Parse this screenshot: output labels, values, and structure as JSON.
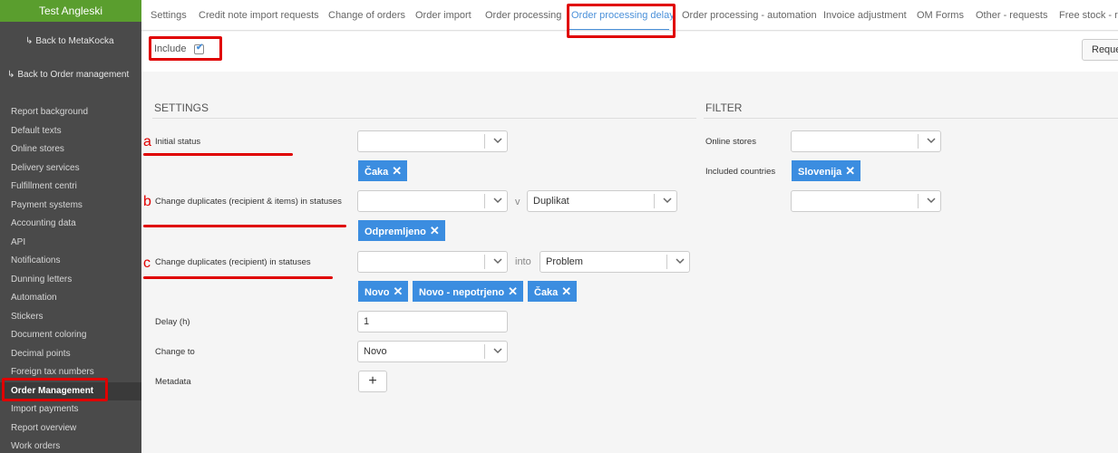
{
  "sidebar": {
    "title": "Test Angleski",
    "back_metakocka": "Back to MetaKocka",
    "back_order_management": "Back to Order management",
    "items": [
      "Report background",
      "Default texts",
      "Online stores",
      "Delivery services",
      "Fulfillment centri",
      "Payment systems",
      "Accounting data",
      "API",
      "Notifications",
      "Dunning letters",
      "Automation",
      "Stickers",
      "Document coloring",
      "Decimal points",
      "Foreign tax numbers",
      "Order Management",
      "Import payments",
      "Report overview",
      "Work orders"
    ],
    "active_item": "Order Management"
  },
  "tabs": [
    "Settings",
    "Credit note import requests",
    "Change of orders",
    "Order import",
    "Order processing",
    "Order processing delay",
    "Order processing - automation",
    "Invoice adjustment",
    "OM Forms",
    "Other - requests",
    "Free stock - res"
  ],
  "active_tab": "Order processing delay",
  "include": {
    "label": "Include",
    "checked": true
  },
  "request_button": "Reque",
  "settings": {
    "title": "SETTINGS",
    "initial_status": {
      "label": "Initial status",
      "value": "",
      "tags": [
        "Čaka"
      ]
    },
    "change_duplicates_items": {
      "label": "Change duplicates (recipient & items) in statuses",
      "value": "",
      "joiner": "v",
      "target": "Duplikat",
      "tags": [
        "Odpremljeno"
      ]
    },
    "change_duplicates_recipient": {
      "label": "Change duplicates (recipient) in statuses",
      "value": "",
      "joiner": "into",
      "target": "Problem",
      "tags": [
        "Novo",
        "Novo - nepotrjeno",
        "Čaka"
      ]
    },
    "delay": {
      "label": "Delay (h)",
      "value": "1"
    },
    "change_to": {
      "label": "Change to",
      "value": "Novo"
    },
    "metadata": {
      "label": "Metadata",
      "button": "+"
    }
  },
  "filter": {
    "title": "FILTER",
    "online_stores": {
      "label": "Online stores",
      "value": ""
    },
    "included_countries": {
      "label": "Included countries",
      "tags": [
        "Slovenija"
      ],
      "value": ""
    }
  },
  "annotations": {
    "a": "a",
    "b": "b",
    "c": "c"
  },
  "colors": {
    "accent": "#4a90d9",
    "tag": "#3b8de0",
    "sidebar_head": "#5a9e2e",
    "annotation": "#e00000"
  }
}
